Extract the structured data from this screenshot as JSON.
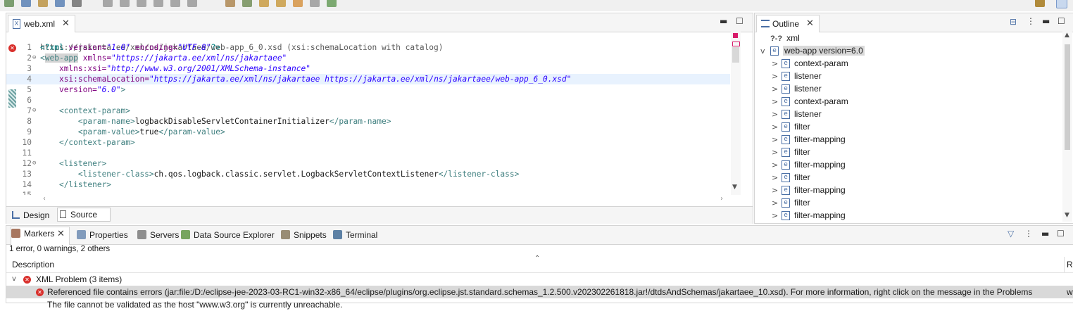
{
  "toolbar": {
    "icons": [
      "debug-icon",
      "run-icon",
      "build-icon",
      "save-icon",
      "search-icon",
      "resume-icon",
      "suspend-icon",
      "terminate-icon",
      "step-into-icon",
      "step-over-icon",
      "step-return-icon",
      "open-type-icon",
      "task-icon",
      "annotation-up-icon",
      "annotation-down-icon",
      "back-icon",
      "forward-icon",
      "new-window-icon"
    ]
  },
  "editor": {
    "tab_label": "web.xml",
    "schema_hint": "https://jakarta.ee/xml/ns/jakartaee/web-app_6_0.xsd (xsi:schemaLocation with catalog)",
    "lines": [
      {
        "n": "1",
        "fold": "",
        "seg": [
          {
            "c": "pi",
            "t": "<?xml "
          },
          {
            "c": "at",
            "t": "version="
          },
          {
            "c": "av",
            "t": "\"1.0\""
          },
          {
            "c": "at",
            "t": " encoding="
          },
          {
            "c": "av",
            "t": "\"UTF-8\""
          },
          {
            "c": "pi",
            "t": "?>"
          }
        ]
      },
      {
        "n": "2",
        "fold": "⊖",
        "seg": [
          {
            "c": "tg",
            "t": "<web-app "
          },
          {
            "c": "at",
            "t": "xmlns="
          },
          {
            "c": "av",
            "t": "\"https://jakarta.ee/xml/ns/jakartaee\""
          }
        ]
      },
      {
        "n": "3",
        "fold": "",
        "seg": [
          {
            "c": "",
            "t": "    "
          },
          {
            "c": "at",
            "t": "xmlns:xsi="
          },
          {
            "c": "av",
            "t": "\"http://www.w3.org/2001/XMLSchema-instance\""
          }
        ]
      },
      {
        "n": "4",
        "fold": "",
        "seg": [
          {
            "c": "",
            "t": "    "
          },
          {
            "c": "at",
            "t": "xsi:schemaLocation="
          },
          {
            "c": "av",
            "t": "\"https://jakarta.ee/xml/ns/jakartaee https://jakarta.ee/xml/ns/jakartaee/web-app_6_0.xsd\""
          }
        ]
      },
      {
        "n": "5",
        "fold": "",
        "seg": [
          {
            "c": "",
            "t": "    "
          },
          {
            "c": "at",
            "t": "version="
          },
          {
            "c": "av",
            "t": "\"6.0\""
          },
          {
            "c": "tg",
            "t": ">"
          }
        ]
      },
      {
        "n": "6",
        "fold": "",
        "seg": []
      },
      {
        "n": "7",
        "fold": "⊖",
        "seg": [
          {
            "c": "",
            "t": "    "
          },
          {
            "c": "tg",
            "t": "<context-param>"
          }
        ]
      },
      {
        "n": "8",
        "fold": "",
        "seg": [
          {
            "c": "",
            "t": "        "
          },
          {
            "c": "tg",
            "t": "<param-name>"
          },
          {
            "c": "",
            "t": "logbackDisableServletContainerInitializer"
          },
          {
            "c": "tg",
            "t": "</param-name>"
          }
        ]
      },
      {
        "n": "9",
        "fold": "",
        "seg": [
          {
            "c": "",
            "t": "        "
          },
          {
            "c": "tg",
            "t": "<param-value>"
          },
          {
            "c": "",
            "t": "true"
          },
          {
            "c": "tg",
            "t": "</param-value>"
          }
        ]
      },
      {
        "n": "10",
        "fold": "",
        "seg": [
          {
            "c": "",
            "t": "    "
          },
          {
            "c": "tg",
            "t": "</context-param>"
          }
        ]
      },
      {
        "n": "11",
        "fold": "",
        "seg": []
      },
      {
        "n": "12",
        "fold": "⊖",
        "seg": [
          {
            "c": "",
            "t": "    "
          },
          {
            "c": "tg",
            "t": "<listener>"
          }
        ]
      },
      {
        "n": "13",
        "fold": "",
        "seg": [
          {
            "c": "",
            "t": "        "
          },
          {
            "c": "tg",
            "t": "<listener-class>"
          },
          {
            "c": "",
            "t": "ch.qos.logback.classic.servlet.LogbackServletContextListener"
          },
          {
            "c": "tg",
            "t": "</listener-class>"
          }
        ]
      },
      {
        "n": "14",
        "fold": "",
        "seg": [
          {
            "c": "",
            "t": "    "
          },
          {
            "c": "tg",
            "t": "</listener>"
          }
        ]
      },
      {
        "n": "15",
        "fold": "",
        "seg": []
      }
    ],
    "mode_tabs": [
      {
        "label": "Design",
        "active": false
      },
      {
        "label": "Source",
        "active": true
      }
    ]
  },
  "outline": {
    "title": "Outline",
    "items": [
      {
        "label": "xml",
        "icon": "?-?",
        "depth": 0,
        "chev": ""
      },
      {
        "label": "web-app version=6.0",
        "icon": "e",
        "depth": 0,
        "chev": "v",
        "selected": true
      },
      {
        "label": "context-param",
        "icon": "e",
        "depth": 1,
        "chev": ">"
      },
      {
        "label": "listener",
        "icon": "e",
        "depth": 1,
        "chev": ">"
      },
      {
        "label": "listener",
        "icon": "e",
        "depth": 1,
        "chev": ">"
      },
      {
        "label": "context-param",
        "icon": "e",
        "depth": 1,
        "chev": ">"
      },
      {
        "label": "listener",
        "icon": "e",
        "depth": 1,
        "chev": ">"
      },
      {
        "label": "filter",
        "icon": "e",
        "depth": 1,
        "chev": ">"
      },
      {
        "label": "filter-mapping",
        "icon": "e",
        "depth": 1,
        "chev": ">"
      },
      {
        "label": "filter",
        "icon": "e",
        "depth": 1,
        "chev": ">"
      },
      {
        "label": "filter-mapping",
        "icon": "e",
        "depth": 1,
        "chev": ">"
      },
      {
        "label": "filter",
        "icon": "e",
        "depth": 1,
        "chev": ">"
      },
      {
        "label": "filter-mapping",
        "icon": "e",
        "depth": 1,
        "chev": ">"
      },
      {
        "label": "filter",
        "icon": "e",
        "depth": 1,
        "chev": ">"
      },
      {
        "label": "filter-mapping",
        "icon": "e",
        "depth": 1,
        "chev": ">"
      }
    ]
  },
  "markers": {
    "tabs": [
      {
        "label": "Markers",
        "name": "markers",
        "color": "#8b4a2b"
      },
      {
        "label": "Properties",
        "name": "properties",
        "color": "#5a7ca8"
      },
      {
        "label": "Servers",
        "name": "servers",
        "color": "#6a6a6a"
      },
      {
        "label": "Data Source Explorer",
        "name": "data-source-explorer",
        "color": "#4c8a2c"
      },
      {
        "label": "Snippets",
        "name": "snippets",
        "color": "#7a6a4a"
      },
      {
        "label": "Terminal",
        "name": "terminal",
        "color": "#2a5a8a"
      }
    ],
    "summary": "1 error, 0 warnings, 2 others",
    "column_description": "Description",
    "column_resource_fragment": "R",
    "group_label": "XML Problem (3 items)",
    "error_row": "Referenced file contains errors (jar:file:/D:/eclipse-jee-2023-03-RC1-win32-x86_64/eclipse/plugins/org.eclipse.jst.standard.schemas_1.2.500.v202302261818.jar!/dtdsAndSchemas/jakartaee_10.xsd).  For more information, right click on the message in the Problems",
    "error_row_tail": "w",
    "next_row_fragment": "The file cannot be validated as the host \"www.w3.org\" is currently unreachable."
  },
  "colors": {
    "error": "#d9302c",
    "selection": "#d9d9d9",
    "current_line": "#e8f2fe"
  }
}
